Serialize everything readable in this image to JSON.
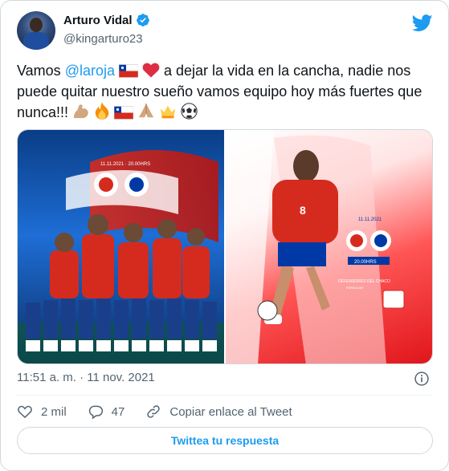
{
  "tweet": {
    "author_name": "Arturo Vidal",
    "author_handle": "@kingarturo23",
    "text_part1": "Vamos ",
    "mention": "@laroja",
    "text_part2": " a dejar la vida  en la cancha, nadie nos puede quitar nuestro sueño vamos equipo hoy más fuertes que nunca!!!",
    "timestamp": "11:51 a. m. · 11 nov. 2021"
  },
  "media": {
    "image1_text": "11.11.2021 · 20.00HRS",
    "image2_date": "11.11.2021",
    "image2_time": "20.00HRS",
    "image2_venue": "DEFENSORES DEL CHACO",
    "image2_city": "PARAGUAY",
    "jersey_number": "8"
  },
  "actions": {
    "like_count": "2 mil",
    "reply_count": "47",
    "copy_link_label": "Copiar enlace al Tweet",
    "reply_button_label": "Twittea tu respuesta"
  },
  "colors": {
    "accent": "#1d9bf0",
    "like_heart": "#e0245e",
    "chile_red": "#d52b1e",
    "chile_blue": "#0039a6"
  },
  "icons": [
    "verified-badge-icon",
    "twitter-bird-icon",
    "info-icon",
    "heart-icon",
    "reply-icon",
    "link-icon",
    "chile-flag-icon",
    "red-heart-emoji",
    "flexed-biceps-emoji",
    "fire-emoji",
    "folded-hands-emoji",
    "crown-emoji",
    "soccer-ball-emoji"
  ]
}
